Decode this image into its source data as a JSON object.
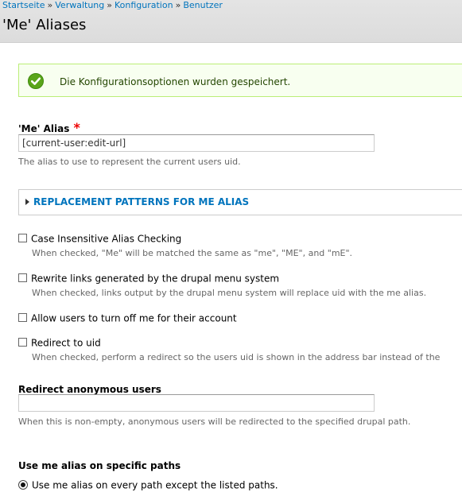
{
  "breadcrumb": {
    "items": [
      "Startseite",
      "Verwaltung",
      "Konfiguration",
      "Benutzer"
    ],
    "separator": "»"
  },
  "page_title": "'Me' Aliases",
  "status_message": {
    "icon": "check-circle-icon",
    "text": "Die Konfigurationsoptionen wurden gespeichert."
  },
  "me_alias": {
    "label": "'Me' Alias",
    "required_marker": "*",
    "value": "[current-user:edit-url]",
    "description": "The alias to use to represent the current users uid."
  },
  "replacement_patterns": {
    "legend": "REPLACEMENT PATTERNS FOR ME ALIAS"
  },
  "options": [
    {
      "label": "Case Insensitive Alias Checking",
      "checked": false,
      "description": "When checked, \"Me\" will be matched the same as \"me\", \"ME\", and \"mE\"."
    },
    {
      "label": "Rewrite links generated by the drupal menu system",
      "checked": false,
      "description": "When checked, links output by the drupal menu system will replace uid with the me alias."
    },
    {
      "label": "Allow users to turn off me for their account",
      "checked": false,
      "description": ""
    },
    {
      "label": "Redirect to uid",
      "checked": false,
      "description": "When checked, perform a redirect so the users uid is shown in the address bar instead of the"
    }
  ],
  "redirect_anonymous": {
    "label": "Redirect anonymous users",
    "value": "",
    "description": "When this is non-empty, anonymous users will be redirected to the specified drupal path."
  },
  "specific_paths": {
    "label": "Use me alias on specific paths",
    "selected_option": "Use me alias on every path except the listed paths."
  },
  "colors": {
    "link": "#0074bd",
    "status_bg": "#f8fff0",
    "status_border": "#bbee77",
    "status_icon": "#5aa51a",
    "required": "#ee0000"
  }
}
